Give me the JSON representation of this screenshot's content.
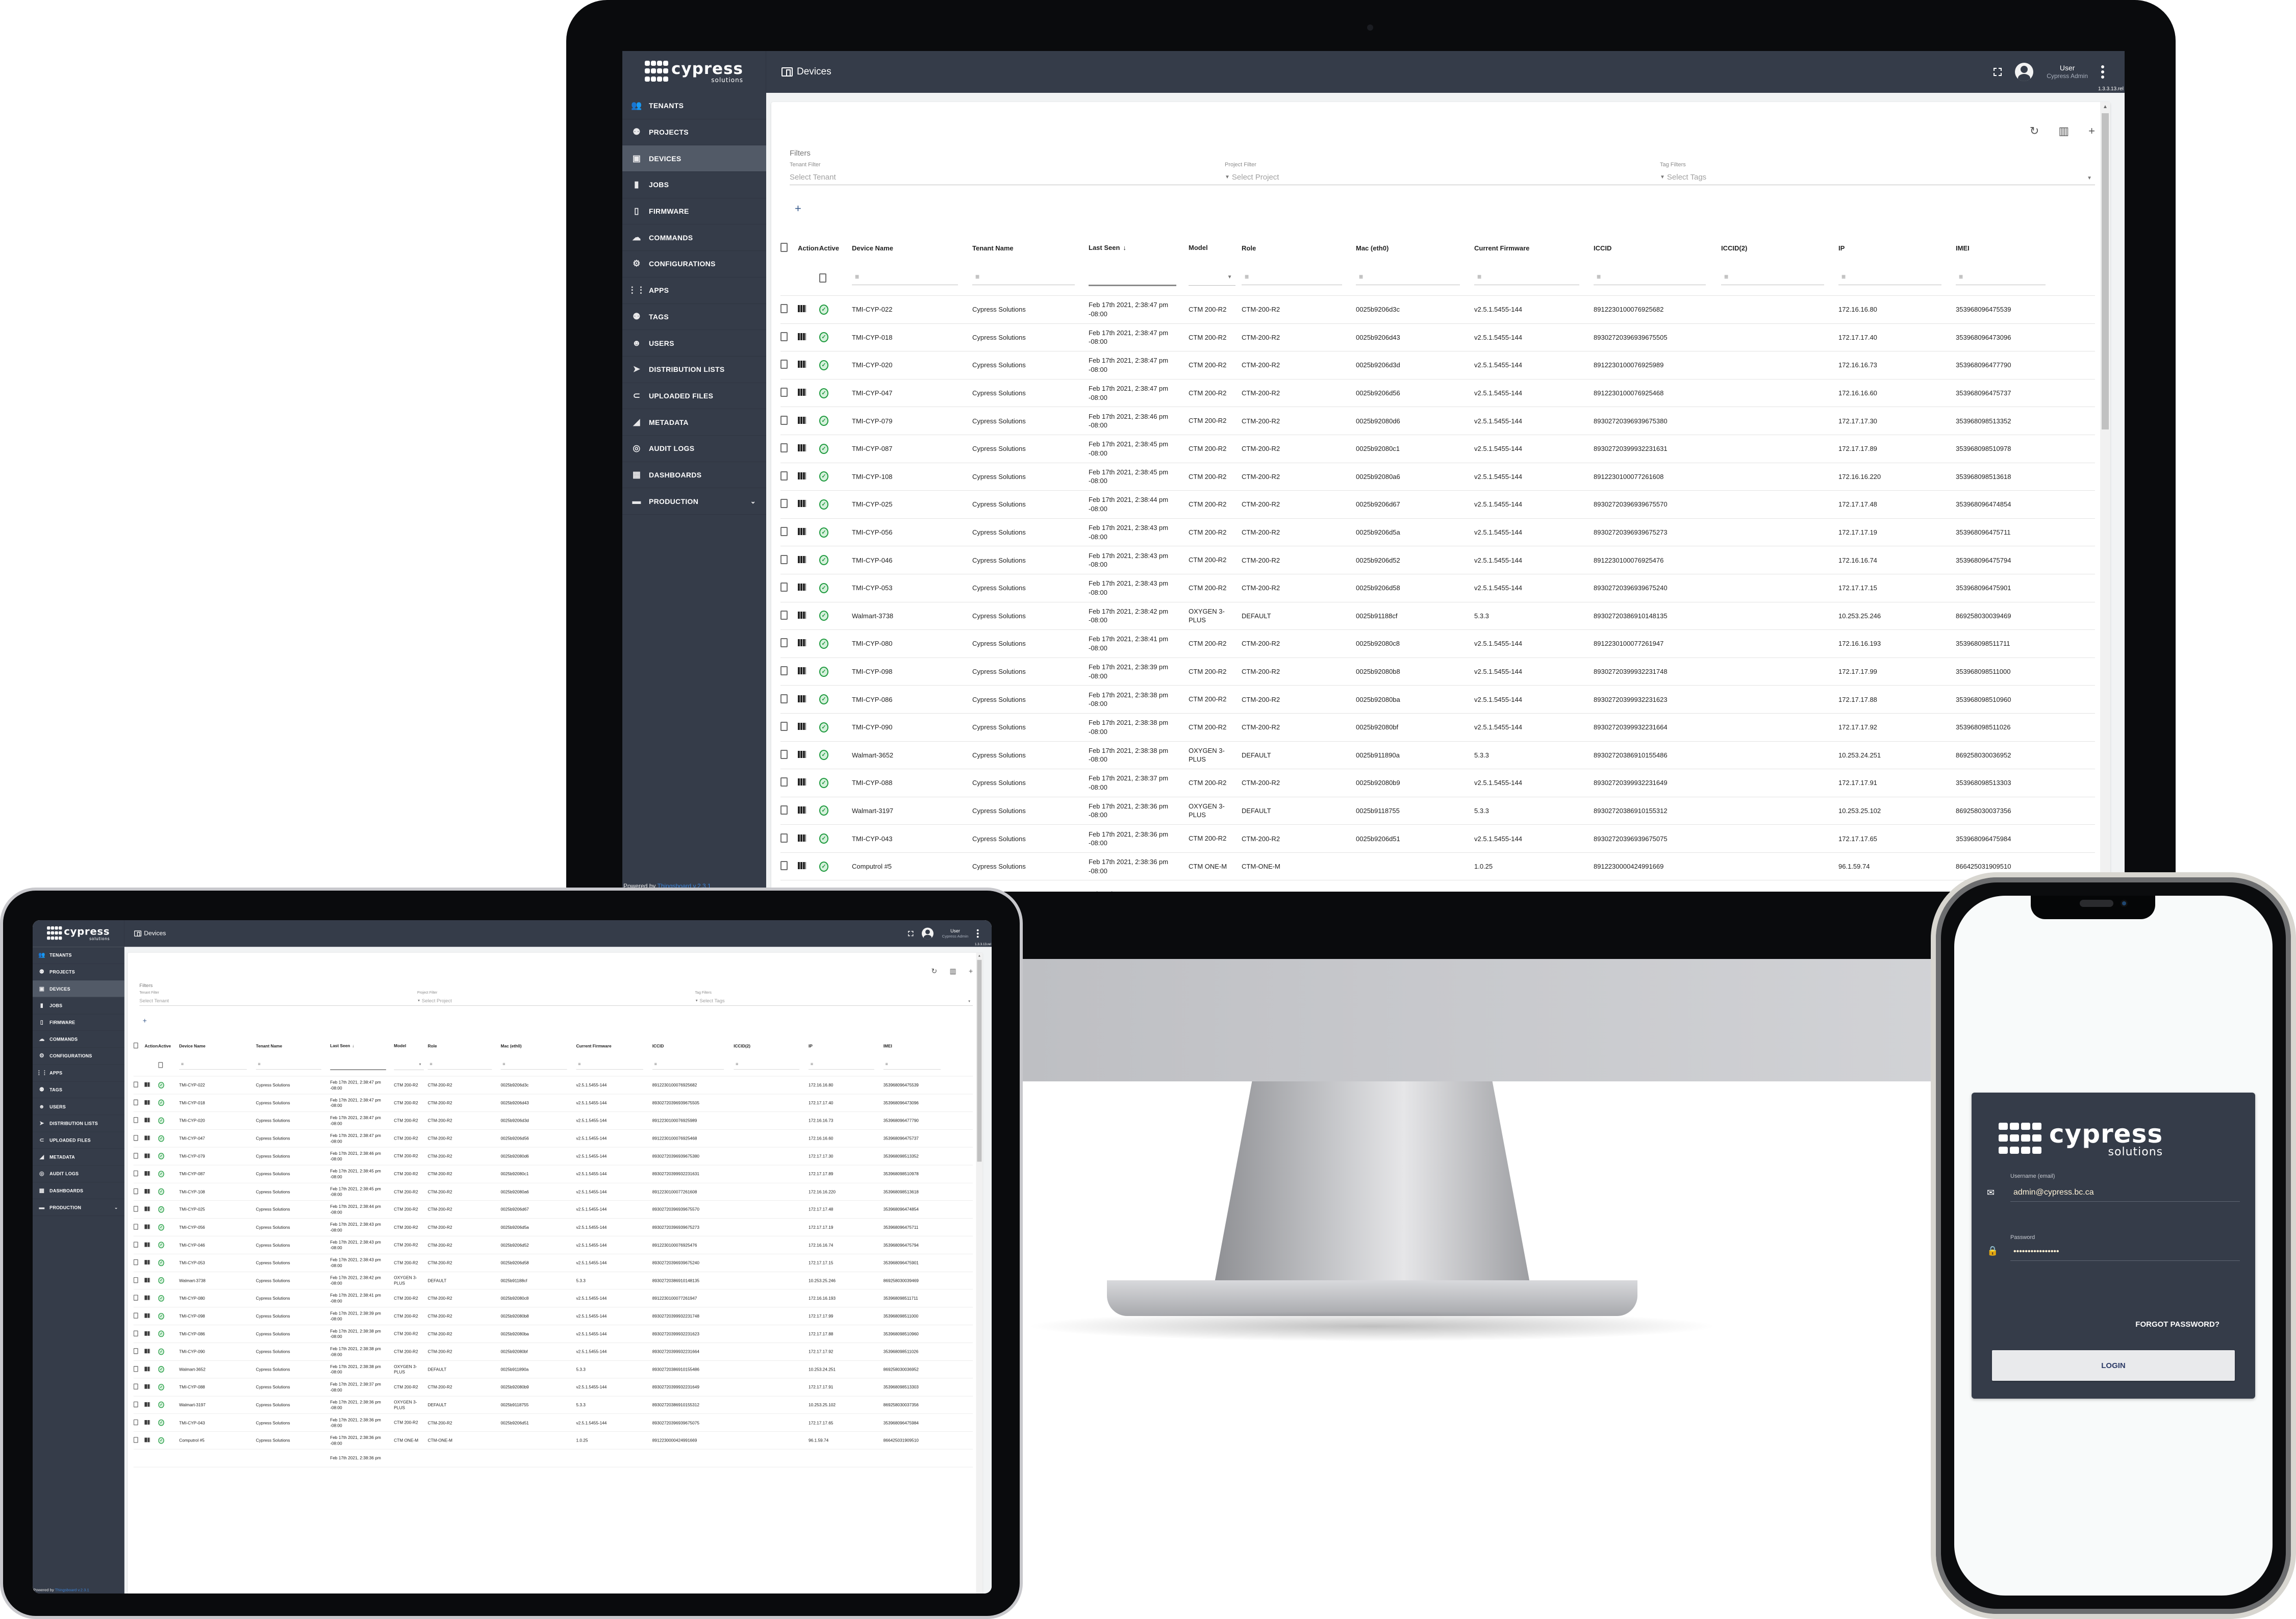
{
  "app": {
    "brand": {
      "name": "cypress",
      "sub": "solutions"
    },
    "page_title": "Devices",
    "user": {
      "name": "User",
      "role": "Cypress Admin"
    },
    "version": "1.3.3.13.rel",
    "sidebar": [
      {
        "label": "TENANTS",
        "icon": "tenants-icon",
        "glyph": "👥"
      },
      {
        "label": "PROJECTS",
        "icon": "projects-icon",
        "glyph": "⚉"
      },
      {
        "label": "DEVICES",
        "icon": "devices-icon",
        "glyph": "▣",
        "active": true
      },
      {
        "label": "JOBS",
        "icon": "folder-icon",
        "glyph": "▮"
      },
      {
        "label": "FIRMWARE",
        "icon": "sd-card-icon",
        "glyph": "▯"
      },
      {
        "label": "COMMANDS",
        "icon": "cloud-upload-icon",
        "glyph": "☁"
      },
      {
        "label": "CONFIGURATIONS",
        "icon": "gear-icon",
        "glyph": "⚙"
      },
      {
        "label": "APPS",
        "icon": "apps-grid-icon",
        "glyph": "⋮⋮"
      },
      {
        "label": "TAGS",
        "icon": "tags-icon",
        "glyph": "⚉"
      },
      {
        "label": "USERS",
        "icon": "user-icon",
        "glyph": "☻"
      },
      {
        "label": "DISTRIBUTION LISTS",
        "icon": "send-icon",
        "glyph": "➤"
      },
      {
        "label": "UPLOADED FILES",
        "icon": "paperclip-icon",
        "glyph": "⊂"
      },
      {
        "label": "METADATA",
        "icon": "metadata-icon",
        "glyph": "◢"
      },
      {
        "label": "AUDIT LOGS",
        "icon": "audit-icon",
        "glyph": "◎"
      },
      {
        "label": "DASHBOARDS",
        "icon": "dashboard-icon",
        "glyph": "▦"
      },
      {
        "label": "PRODUCTION",
        "icon": "folder-icon",
        "glyph": "▬",
        "expandable": true
      }
    ],
    "powered_by": {
      "prefix": "Powered by ",
      "link": "Thingsboard v.2.3.1"
    },
    "toolbar": {
      "refresh": "↻",
      "columns": "▥",
      "add": "+"
    },
    "filters": {
      "title": "Filters",
      "tenant": {
        "label": "Tenant Filter",
        "placeholder": "Select Tenant"
      },
      "project": {
        "label": "Project Filter",
        "placeholder": "Select Project"
      },
      "tags": {
        "label": "Tag Filters",
        "placeholder": "Select Tags"
      },
      "add": "+"
    },
    "table": {
      "columns": [
        "Actions",
        "Active",
        "Device Name",
        "Tenant Name",
        "Last Seen",
        "Model",
        "Role",
        "Mac (eth0)",
        "Current Firmware",
        "ICCID",
        "ICCID(2)",
        "IP",
        "IMEI"
      ],
      "sort_indicator": "↓",
      "rows": [
        {
          "name": "TMI-CYP-022",
          "tenant": "Cypress Solutions",
          "seen": "Feb 17th 2021, 2:38:47 pm -08:00",
          "model": "CTM 200-R2",
          "role": "CTM-200-R2",
          "mac": "0025b9206d3c",
          "fw": "v2.5.1.5455-144",
          "iccid": "8912230100076925682",
          "iccid2": "",
          "ip": "172.16.16.80",
          "imei": "353968096475539"
        },
        {
          "name": "TMI-CYP-018",
          "tenant": "Cypress Solutions",
          "seen": "Feb 17th 2021, 2:38:47 pm -08:00",
          "model": "CTM 200-R2",
          "role": "CTM-200-R2",
          "mac": "0025b9206d43",
          "fw": "v2.5.1.5455-144",
          "iccid": "89302720396939675505",
          "iccid2": "",
          "ip": "172.17.17.40",
          "imei": "353968096473096"
        },
        {
          "name": "TMI-CYP-020",
          "tenant": "Cypress Solutions",
          "seen": "Feb 17th 2021, 2:38:47 pm -08:00",
          "model": "CTM 200-R2",
          "role": "CTM-200-R2",
          "mac": "0025b9206d3d",
          "fw": "v2.5.1.5455-144",
          "iccid": "8912230100076925989",
          "iccid2": "",
          "ip": "172.16.16.73",
          "imei": "353968096477790"
        },
        {
          "name": "TMI-CYP-047",
          "tenant": "Cypress Solutions",
          "seen": "Feb 17th 2021, 2:38:47 pm -08:00",
          "model": "CTM 200-R2",
          "role": "CTM-200-R2",
          "mac": "0025b9206d56",
          "fw": "v2.5.1.5455-144",
          "iccid": "8912230100076925468",
          "iccid2": "",
          "ip": "172.16.16.60",
          "imei": "353968096475737"
        },
        {
          "name": "TMI-CYP-079",
          "tenant": "Cypress Solutions",
          "seen": "Feb 17th 2021, 2:38:46 pm -08:00",
          "model": "CTM 200-R2",
          "role": "CTM-200-R2",
          "mac": "0025b92080d6",
          "fw": "v2.5.1.5455-144",
          "iccid": "89302720396939675380",
          "iccid2": "",
          "ip": "172.17.17.30",
          "imei": "353968098513352"
        },
        {
          "name": "TMI-CYP-087",
          "tenant": "Cypress Solutions",
          "seen": "Feb 17th 2021, 2:38:45 pm -08:00",
          "model": "CTM 200-R2",
          "role": "CTM-200-R2",
          "mac": "0025b92080c1",
          "fw": "v2.5.1.5455-144",
          "iccid": "89302720399932231631",
          "iccid2": "",
          "ip": "172.17.17.89",
          "imei": "353968098510978"
        },
        {
          "name": "TMI-CYP-108",
          "tenant": "Cypress Solutions",
          "seen": "Feb 17th 2021, 2:38:45 pm -08:00",
          "model": "CTM 200-R2",
          "role": "CTM-200-R2",
          "mac": "0025b92080a6",
          "fw": "v2.5.1.5455-144",
          "iccid": "8912230100077261608",
          "iccid2": "",
          "ip": "172.16.16.220",
          "imei": "353968098513618"
        },
        {
          "name": "TMI-CYP-025",
          "tenant": "Cypress Solutions",
          "seen": "Feb 17th 2021, 2:38:44 pm -08:00",
          "model": "CTM 200-R2",
          "role": "CTM-200-R2",
          "mac": "0025b9206d67",
          "fw": "v2.5.1.5455-144",
          "iccid": "89302720396939675570",
          "iccid2": "",
          "ip": "172.17.17.48",
          "imei": "353968096474854"
        },
        {
          "name": "TMI-CYP-056",
          "tenant": "Cypress Solutions",
          "seen": "Feb 17th 2021, 2:38:43 pm -08:00",
          "model": "CTM 200-R2",
          "role": "CTM-200-R2",
          "mac": "0025b9206d5a",
          "fw": "v2.5.1.5455-144",
          "iccid": "89302720396939675273",
          "iccid2": "",
          "ip": "172.17.17.19",
          "imei": "353968096475711"
        },
        {
          "name": "TMI-CYP-046",
          "tenant": "Cypress Solutions",
          "seen": "Feb 17th 2021, 2:38:43 pm -08:00",
          "model": "CTM 200-R2",
          "role": "CTM-200-R2",
          "mac": "0025b9206d52",
          "fw": "v2.5.1.5455-144",
          "iccid": "8912230100076925476",
          "iccid2": "",
          "ip": "172.16.16.74",
          "imei": "353968096475794"
        },
        {
          "name": "TMI-CYP-053",
          "tenant": "Cypress Solutions",
          "seen": "Feb 17th 2021, 2:38:43 pm -08:00",
          "model": "CTM 200-R2",
          "role": "CTM-200-R2",
          "mac": "0025b9206d58",
          "fw": "v2.5.1.5455-144",
          "iccid": "89302720396939675240",
          "iccid2": "",
          "ip": "172.17.17.15",
          "imei": "353968096475901"
        },
        {
          "name": "Walmart-3738",
          "tenant": "Cypress Solutions",
          "seen": "Feb 17th 2021, 2:38:42 pm -08:00",
          "model": "OXYGEN 3-PLUS",
          "role": "DEFAULT",
          "mac": "0025b91188cf",
          "fw": "5.3.3",
          "iccid": "89302720386910148135",
          "iccid2": "",
          "ip": "10.253.25.246",
          "imei": "869258030039469"
        },
        {
          "name": "TMI-CYP-080",
          "tenant": "Cypress Solutions",
          "seen": "Feb 17th 2021, 2:38:41 pm -08:00",
          "model": "CTM 200-R2",
          "role": "CTM-200-R2",
          "mac": "0025b92080c8",
          "fw": "v2.5.1.5455-144",
          "iccid": "8912230100077261947",
          "iccid2": "",
          "ip": "172.16.16.193",
          "imei": "353968098511711"
        },
        {
          "name": "TMI-CYP-098",
          "tenant": "Cypress Solutions",
          "seen": "Feb 17th 2021, 2:38:39 pm -08:00",
          "model": "CTM 200-R2",
          "role": "CTM-200-R2",
          "mac": "0025b92080b8",
          "fw": "v2.5.1.5455-144",
          "iccid": "89302720399932231748",
          "iccid2": "",
          "ip": "172.17.17.99",
          "imei": "353968098511000"
        },
        {
          "name": "TMI-CYP-086",
          "tenant": "Cypress Solutions",
          "seen": "Feb 17th 2021, 2:38:38 pm -08:00",
          "model": "CTM 200-R2",
          "role": "CTM-200-R2",
          "mac": "0025b92080ba",
          "fw": "v2.5.1.5455-144",
          "iccid": "89302720399932231623",
          "iccid2": "",
          "ip": "172.17.17.88",
          "imei": "353968098510960"
        },
        {
          "name": "TMI-CYP-090",
          "tenant": "Cypress Solutions",
          "seen": "Feb 17th 2021, 2:38:38 pm -08:00",
          "model": "CTM 200-R2",
          "role": "CTM-200-R2",
          "mac": "0025b92080bf",
          "fw": "v2.5.1.5455-144",
          "iccid": "89302720399932231664",
          "iccid2": "",
          "ip": "172.17.17.92",
          "imei": "353968098511026"
        },
        {
          "name": "Walmart-3652",
          "tenant": "Cypress Solutions",
          "seen": "Feb 17th 2021, 2:38:38 pm -08:00",
          "model": "OXYGEN 3-PLUS",
          "role": "DEFAULT",
          "mac": "0025b911890a",
          "fw": "5.3.3",
          "iccid": "89302720386910155486",
          "iccid2": "",
          "ip": "10.253.24.251",
          "imei": "869258030036952"
        },
        {
          "name": "TMI-CYP-088",
          "tenant": "Cypress Solutions",
          "seen": "Feb 17th 2021, 2:38:37 pm -08:00",
          "model": "CTM 200-R2",
          "role": "CTM-200-R2",
          "mac": "0025b92080b9",
          "fw": "v2.5.1.5455-144",
          "iccid": "89302720399932231649",
          "iccid2": "",
          "ip": "172.17.17.91",
          "imei": "353968098513303"
        },
        {
          "name": "Walmart-3197",
          "tenant": "Cypress Solutions",
          "seen": "Feb 17th 2021, 2:38:36 pm -08:00",
          "model": "OXYGEN 3-PLUS",
          "role": "DEFAULT",
          "mac": "0025b9118755",
          "fw": "5.3.3",
          "iccid": "89302720386910155312",
          "iccid2": "",
          "ip": "10.253.25.102",
          "imei": "869258030037356"
        },
        {
          "name": "TMI-CYP-043",
          "tenant": "Cypress Solutions",
          "seen": "Feb 17th 2021, 2:38:36 pm -08:00",
          "model": "CTM 200-R2",
          "role": "CTM-200-R2",
          "mac": "0025b9206d51",
          "fw": "v2.5.1.5455-144",
          "iccid": "89302720396939675075",
          "iccid2": "",
          "ip": "172.17.17.65",
          "imei": "353968096475984"
        },
        {
          "name": "Computrol #5",
          "tenant": "Cypress Solutions",
          "seen": "Feb 17th 2021, 2:38:36 pm -08:00",
          "model": "CTM ONE-M",
          "role": "CTM-ONE-M",
          "mac": "",
          "fw": "1.0.25",
          "iccid": "8912230000424991669",
          "iccid2": "",
          "ip": "96.1.59.74",
          "imei": "866425031909510"
        },
        {
          "name": "",
          "tenant": "",
          "seen": "Feb 17th 2021, 2:38:36 pm",
          "model": "",
          "role": "",
          "mac": "",
          "fw": "",
          "iccid": "",
          "iccid2": "",
          "ip": "",
          "imei": ""
        }
      ]
    }
  },
  "login": {
    "brand": {
      "name": "cypress",
      "sub": "solutions"
    },
    "username_label": "Username (email)",
    "username_value": "admin@cypress.bc.ca",
    "password_label": "Password",
    "password_value": "••••••••••••••••",
    "forgot_label": "FORGOT PASSWORD?",
    "login_label": "LOGIN"
  }
}
